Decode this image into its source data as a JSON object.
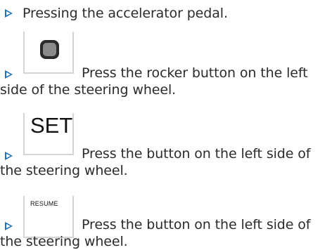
{
  "items": [
    {
      "text": "Pressing the accelerator pedal."
    },
    {
      "text_line1": "Press the rocker button on the left",
      "text_line2": "side of the steering wheel.",
      "icon": "rocker-button-icon"
    },
    {
      "text_line1": "Press the button on the left side of",
      "text_line2": "the steering wheel.",
      "icon_label": "SET"
    },
    {
      "text_line1": "Press the button on the left side of",
      "text_line2": "the steering wheel.",
      "icon_label": "RESUME"
    }
  ],
  "colors": {
    "bullet": "#1d73b8",
    "text": "#2b2b2b",
    "icon_border": "#d4d4d4"
  }
}
